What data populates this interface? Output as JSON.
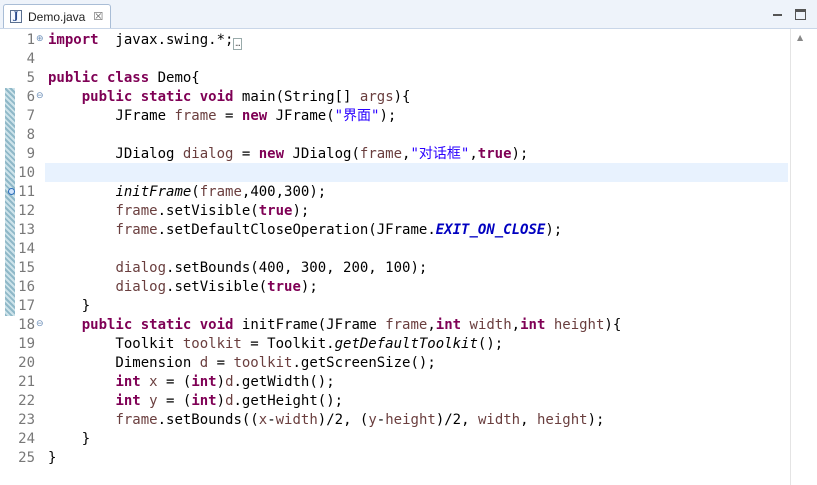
{
  "tab": {
    "title": "Demo.java",
    "icon": "java-file-icon",
    "close_glyph": "☒"
  },
  "editor": {
    "lines": [
      {
        "num": "1",
        "fold": "⊕",
        "segments": [
          [
            "kw",
            "import"
          ],
          [
            "",
            "  javax.swing.*;"
          ],
          [
            "box",
            "…"
          ]
        ]
      },
      {
        "num": "4",
        "fold": "",
        "segments": []
      },
      {
        "num": "5",
        "fold": "",
        "segments": [
          [
            "kw",
            "public"
          ],
          [
            "",
            ""
          ],
          [
            "kw",
            " class"
          ],
          [
            "",
            ""
          ],
          [
            "",
            " Demo{"
          ]
        ]
      },
      {
        "num": "6",
        "fold": "⊖",
        "segments": [
          [
            "",
            "    "
          ],
          [
            "kw",
            "public"
          ],
          [
            "",
            " "
          ],
          [
            "kw",
            "static"
          ],
          [
            "",
            " "
          ],
          [
            "kw",
            "void"
          ],
          [
            "",
            " main(String[] "
          ],
          [
            "var",
            "args"
          ],
          [
            "",
            "){"
          ]
        ]
      },
      {
        "num": "7",
        "fold": "",
        "segments": [
          [
            "",
            "        JFrame "
          ],
          [
            "var",
            "frame"
          ],
          [
            "",
            " = "
          ],
          [
            "kw",
            "new"
          ],
          [
            "",
            " JFrame("
          ],
          [
            "str",
            "\"界面\""
          ],
          [
            "",
            ");"
          ]
        ]
      },
      {
        "num": "8",
        "fold": "",
        "segments": []
      },
      {
        "num": "9",
        "fold": "",
        "segments": [
          [
            "",
            "        JDialog "
          ],
          [
            "var",
            "dialog"
          ],
          [
            "",
            " = "
          ],
          [
            "kw",
            "new"
          ],
          [
            "",
            " JDialog("
          ],
          [
            "var",
            "frame"
          ],
          [
            "",
            ","
          ],
          [
            "str",
            "\"对话框\""
          ],
          [
            "",
            ","
          ],
          [
            "kw",
            "true"
          ],
          [
            "",
            ");"
          ]
        ]
      },
      {
        "num": "10",
        "fold": "",
        "segments": []
      },
      {
        "num": "11",
        "fold": "",
        "segments": [
          [
            "",
            "        "
          ],
          [
            "ital",
            "initFrame"
          ],
          [
            "",
            "("
          ],
          [
            "var",
            "frame"
          ],
          [
            "",
            ",400,300);"
          ]
        ]
      },
      {
        "num": "12",
        "fold": "",
        "segments": [
          [
            "",
            "        "
          ],
          [
            "var",
            "frame"
          ],
          [
            "",
            ".setVisible("
          ],
          [
            "kw",
            "true"
          ],
          [
            "",
            ");"
          ]
        ]
      },
      {
        "num": "13",
        "fold": "",
        "segments": [
          [
            "",
            "        "
          ],
          [
            "var",
            "frame"
          ],
          [
            "",
            ".setDefaultCloseOperation(JFrame."
          ],
          [
            "fld",
            "EXIT_ON_CLOSE"
          ],
          [
            "",
            ");"
          ]
        ]
      },
      {
        "num": "14",
        "fold": "",
        "segments": []
      },
      {
        "num": "15",
        "fold": "",
        "segments": [
          [
            "",
            "        "
          ],
          [
            "var",
            "dialog"
          ],
          [
            "",
            ".setBounds(400, 300, 200, 100);"
          ]
        ]
      },
      {
        "num": "16",
        "fold": "",
        "segments": [
          [
            "",
            "        "
          ],
          [
            "var",
            "dialog"
          ],
          [
            "",
            ".setVisible("
          ],
          [
            "kw",
            "true"
          ],
          [
            "",
            ");"
          ]
        ]
      },
      {
        "num": "17",
        "fold": "",
        "segments": [
          [
            "",
            "    }"
          ]
        ]
      },
      {
        "num": "18",
        "fold": "⊖",
        "segments": [
          [
            "",
            "    "
          ],
          [
            "kw",
            "public"
          ],
          [
            "",
            " "
          ],
          [
            "kw",
            "static"
          ],
          [
            "",
            " "
          ],
          [
            "kw",
            "void"
          ],
          [
            "",
            " initFrame(JFrame "
          ],
          [
            "var",
            "frame"
          ],
          [
            "",
            ","
          ],
          [
            "kw",
            "int"
          ],
          [
            "",
            " "
          ],
          [
            "var",
            "width"
          ],
          [
            "",
            ","
          ],
          [
            "kw",
            "int"
          ],
          [
            "",
            " "
          ],
          [
            "var",
            "height"
          ],
          [
            "",
            "){"
          ]
        ]
      },
      {
        "num": "19",
        "fold": "",
        "segments": [
          [
            "",
            "        Toolkit "
          ],
          [
            "var",
            "toolkit"
          ],
          [
            "",
            " = Toolkit."
          ],
          [
            "ital",
            "getDefaultToolkit"
          ],
          [
            "",
            "();"
          ]
        ]
      },
      {
        "num": "20",
        "fold": "",
        "segments": [
          [
            "",
            "        Dimension "
          ],
          [
            "var",
            "d"
          ],
          [
            "",
            " = "
          ],
          [
            "var",
            "toolkit"
          ],
          [
            "",
            ".getScreenSize();"
          ]
        ]
      },
      {
        "num": "21",
        "fold": "",
        "segments": [
          [
            "",
            "        "
          ],
          [
            "kw",
            "int"
          ],
          [
            "",
            " "
          ],
          [
            "var",
            "x"
          ],
          [
            "",
            " = ("
          ],
          [
            "kw",
            "int"
          ],
          [
            "",
            ")"
          ],
          [
            "var",
            "d"
          ],
          [
            "",
            ".getWidth();"
          ]
        ]
      },
      {
        "num": "22",
        "fold": "",
        "segments": [
          [
            "",
            "        "
          ],
          [
            "kw",
            "int"
          ],
          [
            "",
            " "
          ],
          [
            "var",
            "y"
          ],
          [
            "",
            " = ("
          ],
          [
            "kw",
            "int"
          ],
          [
            "",
            ")"
          ],
          [
            "var",
            "d"
          ],
          [
            "",
            ".getHeight();"
          ]
        ]
      },
      {
        "num": "23",
        "fold": "",
        "segments": [
          [
            "",
            "        "
          ],
          [
            "var",
            "frame"
          ],
          [
            "",
            ".setBounds(("
          ],
          [
            "var",
            "x"
          ],
          [
            "",
            "-"
          ],
          [
            "var",
            "width"
          ],
          [
            "",
            ")/2, ("
          ],
          [
            "var",
            "y"
          ],
          [
            "",
            "-"
          ],
          [
            "var",
            "height"
          ],
          [
            "",
            ")/2, "
          ],
          [
            "var",
            "width"
          ],
          [
            "",
            ", "
          ],
          [
            "var",
            "height"
          ],
          [
            "",
            ");"
          ]
        ]
      },
      {
        "num": "24",
        "fold": "",
        "segments": [
          [
            "",
            "    }"
          ]
        ]
      },
      {
        "num": "25",
        "fold": "",
        "segments": [
          [
            "",
            "}"
          ]
        ]
      }
    ],
    "colors": {
      "keyword": "#7f0055",
      "local_variable": "#6a3e3e",
      "static_field": "#0000c0",
      "string": "#2a00ff",
      "line_number": "#787878",
      "current_line": "#e8f2fe"
    }
  }
}
